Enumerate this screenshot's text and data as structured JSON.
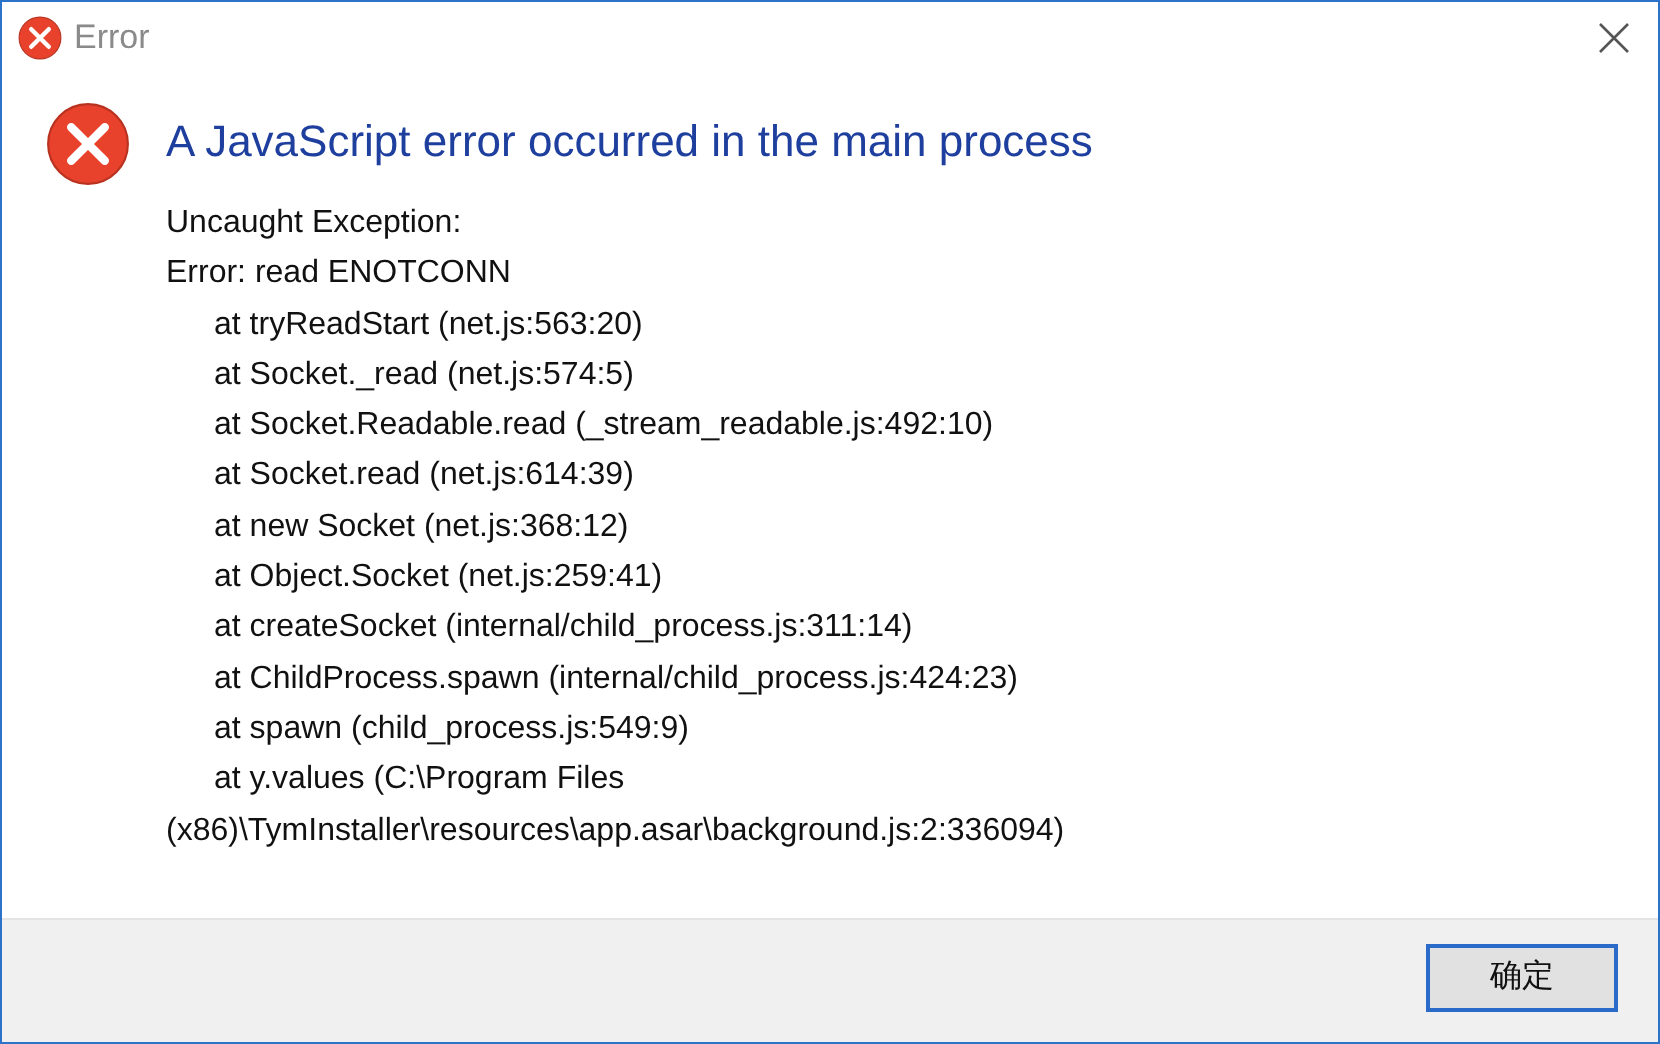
{
  "window": {
    "title": "Error"
  },
  "heading": "A JavaScript error occurred in the main process",
  "lines": [
    {
      "text": "Uncaught Exception:",
      "kind": "plain"
    },
    {
      "text": "Error: read ENOTCONN",
      "kind": "plain"
    },
    {
      "text": "at tryReadStart (net.js:563:20)",
      "kind": "indented"
    },
    {
      "text": "at Socket._read (net.js:574:5)",
      "kind": "indented"
    },
    {
      "text": "at Socket.Readable.read (_stream_readable.js:492:10)",
      "kind": "indented"
    },
    {
      "text": "at Socket.read (net.js:614:39)",
      "kind": "indented"
    },
    {
      "text": "at new Socket (net.js:368:12)",
      "kind": "indented"
    },
    {
      "text": "at Object.Socket (net.js:259:41)",
      "kind": "indented"
    },
    {
      "text": "at createSocket (internal/child_process.js:311:14)",
      "kind": "indented"
    },
    {
      "text": "at ChildProcess.spawn (internal/child_process.js:424:23)",
      "kind": "indented"
    },
    {
      "text": "at spawn (child_process.js:549:9)",
      "kind": "indented"
    },
    {
      "text": "at y.values (C:\\Program Files",
      "kind": "indented"
    },
    {
      "text": "(x86)\\TymInstaller\\resources\\app.asar\\background.js:2:336094)",
      "kind": "plain"
    }
  ],
  "buttons": [
    {
      "label": "确定"
    }
  ]
}
